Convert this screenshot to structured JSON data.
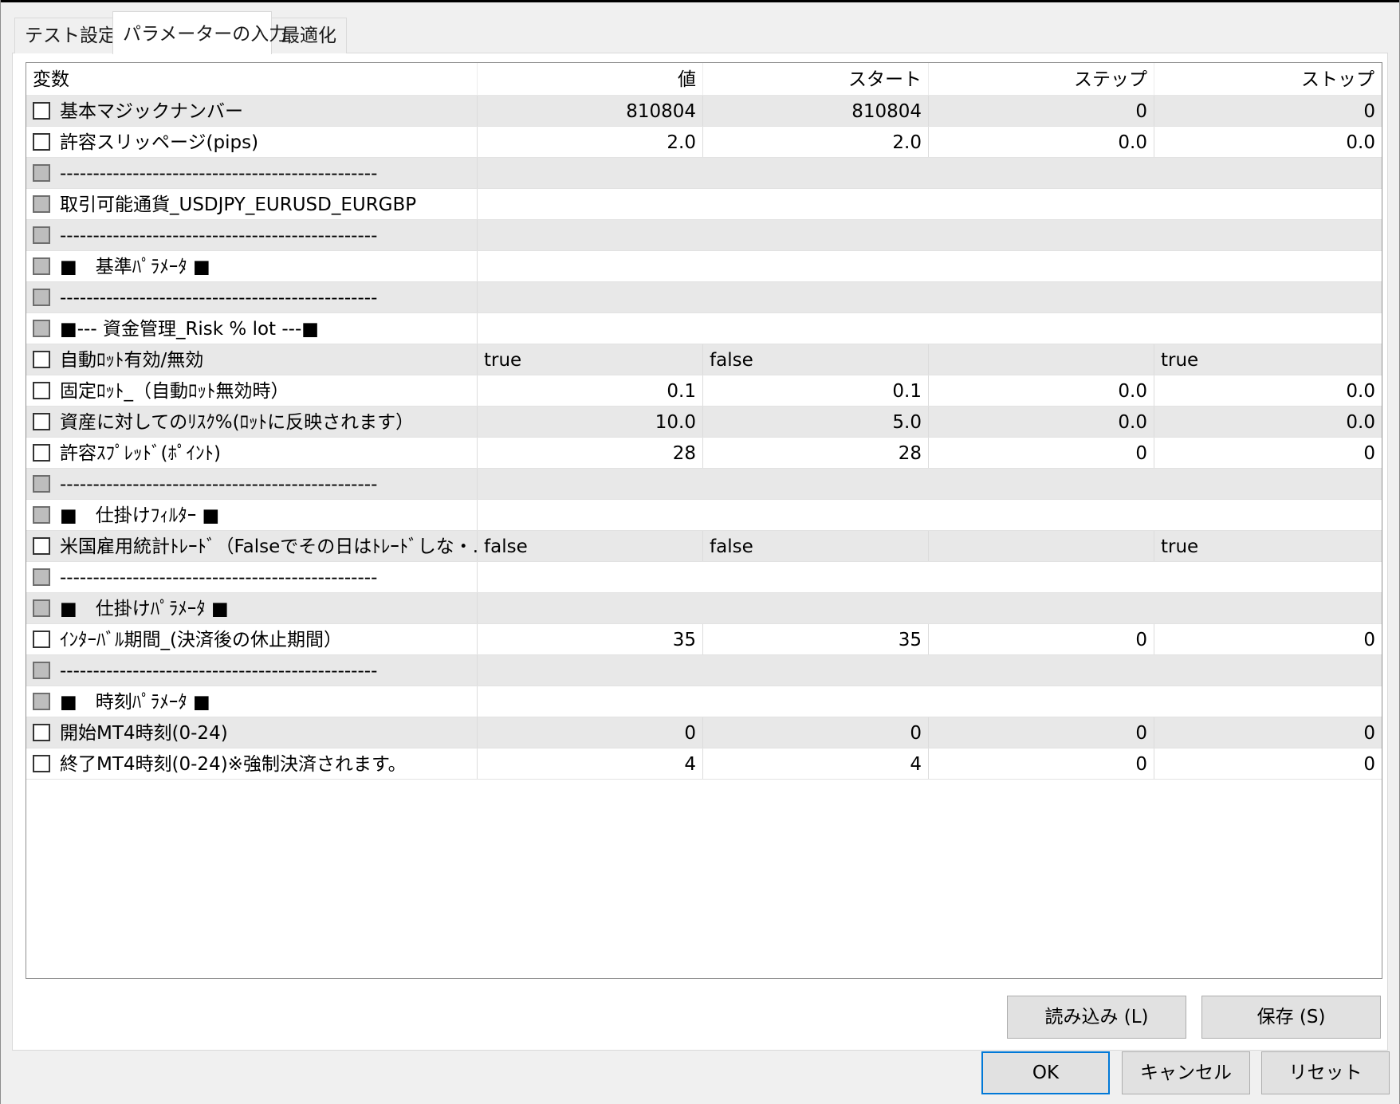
{
  "tabs": [
    "テスト設定",
    "パラメーターの入力",
    "最適化"
  ],
  "table": {
    "headers": [
      "変数",
      "値",
      "スタート",
      "ステップ",
      "ストップ"
    ],
    "rows": [
      {
        "name": "基本マジックナンバー",
        "value": "810804",
        "start": "810804",
        "step": "0",
        "stop": "0"
      },
      {
        "name": "許容スリッページ(pips)",
        "value": "2.0",
        "start": "2.0",
        "step": "0.0",
        "stop": "0.0"
      },
      {
        "name": "------------------------------------------------",
        "separator": true
      },
      {
        "name": "取引可能通貨_USDJPY_EURUSD_EURGBP",
        "separator": true
      },
      {
        "name": "------------------------------------------------",
        "separator": true
      },
      {
        "name": "■　基準ﾊﾟﾗﾒｰﾀ ■",
        "separator": true
      },
      {
        "name": "------------------------------------------------",
        "separator": true
      },
      {
        "name": "■--- 資金管理_Risk % lot ---■",
        "separator": true
      },
      {
        "name": "自動ﾛｯﾄ有効/無効",
        "value": "true",
        "start": "false",
        "step": "",
        "stop": "true",
        "text": true
      },
      {
        "name": "固定ﾛｯﾄ_（自動ﾛｯﾄ無効時）",
        "value": "0.1",
        "start": "0.1",
        "step": "0.0",
        "stop": "0.0"
      },
      {
        "name": "資産に対してのﾘｽｸ%(ﾛｯﾄに反映されます）",
        "value": "10.0",
        "start": "5.0",
        "step": "0.0",
        "stop": "0.0"
      },
      {
        "name": "許容ｽﾌﾟﾚｯﾄﾞ(ﾎﾟｲﾝﾄ)",
        "value": "28",
        "start": "28",
        "step": "0",
        "stop": "0"
      },
      {
        "name": "------------------------------------------------",
        "separator": true
      },
      {
        "name": "■　仕掛けﾌｨﾙﾀｰ ■",
        "separator": true
      },
      {
        "name": "米国雇用統計ﾄﾚｰﾄﾞ（Falseでその日はﾄﾚｰﾄﾞしな・..",
        "value": "false",
        "start": "false",
        "step": "",
        "stop": "true",
        "text": true
      },
      {
        "name": "------------------------------------------------",
        "separator": true
      },
      {
        "name": "■　仕掛けﾊﾟﾗﾒｰﾀ ■",
        "separator": true
      },
      {
        "name": "ｲﾝﾀｰﾊﾞﾙ期間_(決済後の休止期間）",
        "value": "35",
        "start": "35",
        "step": "0",
        "stop": "0"
      },
      {
        "name": "------------------------------------------------",
        "separator": true
      },
      {
        "name": "■　時刻ﾊﾟﾗﾒｰﾀ ■",
        "separator": true
      },
      {
        "name": "開始MT4時刻(0-24)",
        "value": "0",
        "start": "0",
        "step": "0",
        "stop": "0"
      },
      {
        "name": "終了MT4時刻(0-24)※強制決済されます。",
        "value": "4",
        "start": "4",
        "step": "0",
        "stop": "0"
      }
    ]
  },
  "buttons": {
    "load": "読み込み (L)",
    "save": "保存 (S)",
    "ok": "OK",
    "cancel": "キャンセル",
    "reset": "リセット"
  }
}
